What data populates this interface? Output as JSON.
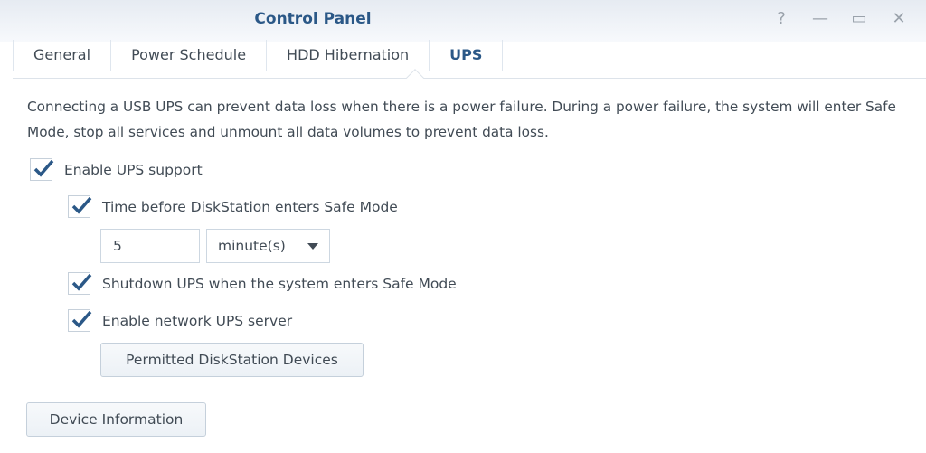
{
  "window": {
    "title": "Control Panel",
    "controls": {
      "help": "?",
      "minimize": "—",
      "maximize": "▭",
      "close": "✕"
    }
  },
  "tabs": [
    {
      "label": "General",
      "active": false
    },
    {
      "label": "Power Schedule",
      "active": false
    },
    {
      "label": "HDD Hibernation",
      "active": false
    },
    {
      "label": "UPS",
      "active": true
    }
  ],
  "description": "Connecting a USB UPS can prevent data loss when there is a power failure. During a power failure, the system will enter Safe Mode, stop all services and unmount all data volumes to prevent data loss.",
  "options": {
    "enable_ups": {
      "label": "Enable UPS support",
      "checked": true
    },
    "safe_mode_time": {
      "label": "Time before DiskStation enters Safe Mode",
      "checked": true,
      "value": "5",
      "unit": "minute(s)"
    },
    "shutdown_ups": {
      "label": "Shutdown UPS when the system enters Safe Mode",
      "checked": true
    },
    "network_ups": {
      "label": "Enable network UPS server",
      "checked": true
    }
  },
  "buttons": {
    "permitted_devices": "Permitted DiskStation Devices",
    "device_info": "Device Information"
  },
  "colors": {
    "accent": "#2b5887",
    "text": "#414b55"
  }
}
